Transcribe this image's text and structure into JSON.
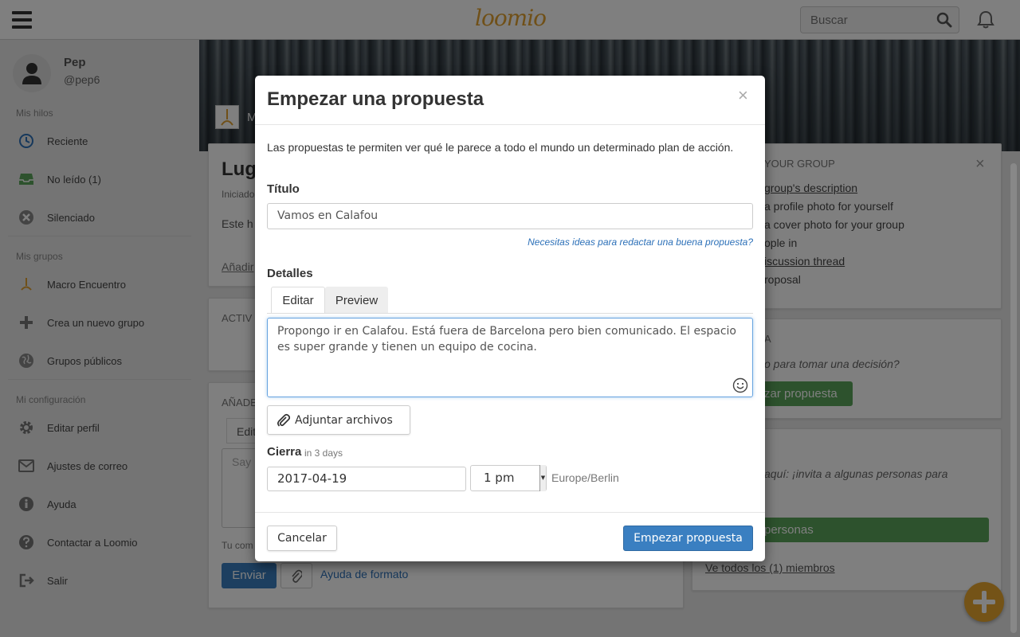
{
  "topbar": {
    "logo": "loomio",
    "search_placeholder": "Buscar"
  },
  "sidebar": {
    "user_name": "Pep",
    "user_handle": "@pep6",
    "threads_section": "Mis hilos",
    "threads": [
      {
        "label": "Reciente",
        "icon": "clock-icon"
      },
      {
        "label": "No leído (1)",
        "icon": "inbox-icon"
      },
      {
        "label": "Silenciado",
        "icon": "mute-icon"
      }
    ],
    "groups_section": "Mis grupos",
    "groups": [
      {
        "label": "Macro Encuentro",
        "icon": "group-logo-icon"
      },
      {
        "label": "Crea un nuevo grupo",
        "icon": "plus-icon"
      },
      {
        "label": "Grupos públicos",
        "icon": "globe-icon"
      }
    ],
    "config_section": "Mi configuración",
    "config": [
      {
        "label": "Editar perfil",
        "icon": "gear-icon"
      },
      {
        "label": "Ajustes de correo",
        "icon": "envelope-icon"
      },
      {
        "label": "Ayuda",
        "icon": "info-icon"
      },
      {
        "label": "Contactar a Loomio",
        "icon": "question-icon"
      },
      {
        "label": "Salir",
        "icon": "signout-icon"
      }
    ]
  },
  "background": {
    "group_initial": "M",
    "thread_title": "Lug",
    "thread_meta": "Iniciado",
    "thread_body": "Este h",
    "thread_add": "Añadir",
    "activity_title": "ACTIV",
    "add_comment_title": "AÑADE",
    "comment_tab": "Edit",
    "comment_placeholder": "Say",
    "comment_hint": "Tu com",
    "send_button": "Enviar",
    "format_help": "Ayuda de formato",
    "setup_title": "YOUR GROUP",
    "setup_items": [
      "group's description",
      "a profile photo for yourself",
      "a cover photo for your group",
      "ople in",
      "iscussion thread",
      "roposal"
    ],
    "decision_title": "A",
    "decision_text": "o para tomar una decisión?",
    "decision_button": "zar propuesta",
    "invite_text": "aquí: ¡invita a algunas personas para",
    "invite_button": "personas",
    "members_link": "Ve todos los (1) miembros"
  },
  "modal": {
    "title": "Empezar una propuesta",
    "close": "×",
    "intro": "Las propuestas te permiten ver qué le parece a todo el mundo un determinado plan de acción.",
    "title_label": "Título",
    "title_value": "Vamos en Calafou",
    "title_hint": "Necesitas ideas para redactar una buena propuesta?",
    "details_label": "Detalles",
    "tab_edit": "Editar",
    "tab_preview": "Preview",
    "details_value": "Propongo ir en Calafou. Está fuera de Barcelona pero bien comunicado. El espacio es super grande y tienen un equipo de cocina.",
    "attach_label": "Adjuntar archivos",
    "closes_label": "Cierra",
    "closes_hint": "in 3 days",
    "closing_date": "2017-04-19",
    "closing_time": "1 pm",
    "timezone": "Europe/Berlin",
    "cancel_label": "Cancelar",
    "submit_label": "Empezar propuesta"
  },
  "colors": {
    "accent_blue": "#3a7fc1",
    "logo_orange": "#e0a030",
    "green": "#5aa45a"
  }
}
